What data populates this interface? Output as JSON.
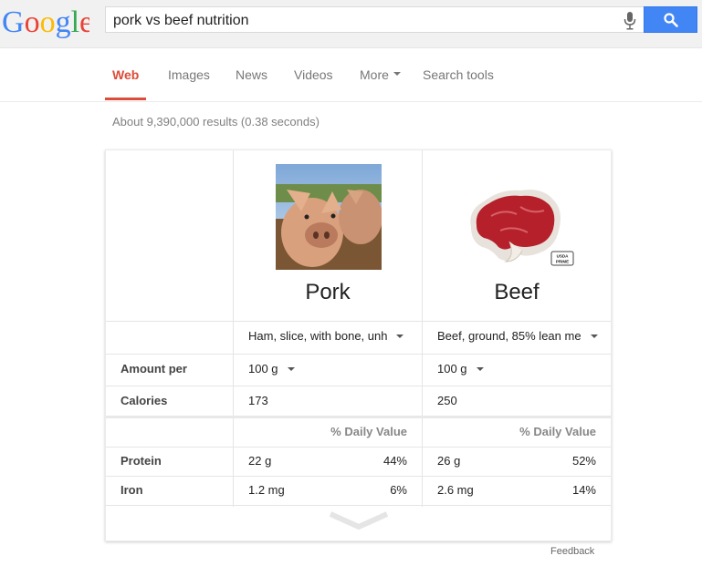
{
  "search": {
    "query": "pork vs beef nutrition"
  },
  "logo": {
    "letters": [
      "G",
      "o",
      "o",
      "g",
      "l",
      "e"
    ],
    "colors": [
      "#4285f4",
      "#ea4335",
      "#fbbc05",
      "#4285f4",
      "#34a853",
      "#ea4335"
    ]
  },
  "tabs": [
    {
      "label": "Web",
      "active": true
    },
    {
      "label": "Images"
    },
    {
      "label": "News"
    },
    {
      "label": "Videos"
    },
    {
      "label": "More"
    },
    {
      "label": "Search tools"
    }
  ],
  "result_stats": "About 9,390,000 results (0.38 seconds)",
  "comparison": {
    "items": [
      {
        "name": "Pork",
        "variant": "Ham, slice, with bone, unh",
        "amount": "100 g",
        "calories": "173",
        "protein": "22 g",
        "protein_dv": "44%",
        "iron": "1.2 mg",
        "iron_dv": "6%",
        "badge": ""
      },
      {
        "name": "Beef",
        "variant": "Beef, ground, 85% lean me",
        "amount": "100 g",
        "calories": "250",
        "protein": "26 g",
        "protein_dv": "52%",
        "iron": "2.6 mg",
        "iron_dv": "14%",
        "badge": "USDA PRIME"
      }
    ],
    "labels": {
      "amount_per": "Amount per",
      "calories": "Calories",
      "daily_value": "% Daily Value",
      "protein": "Protein",
      "iron": "Iron"
    }
  },
  "feedback": "Feedback",
  "colors": {
    "accent": "#dd4b39",
    "search_button": "#4285f4"
  }
}
